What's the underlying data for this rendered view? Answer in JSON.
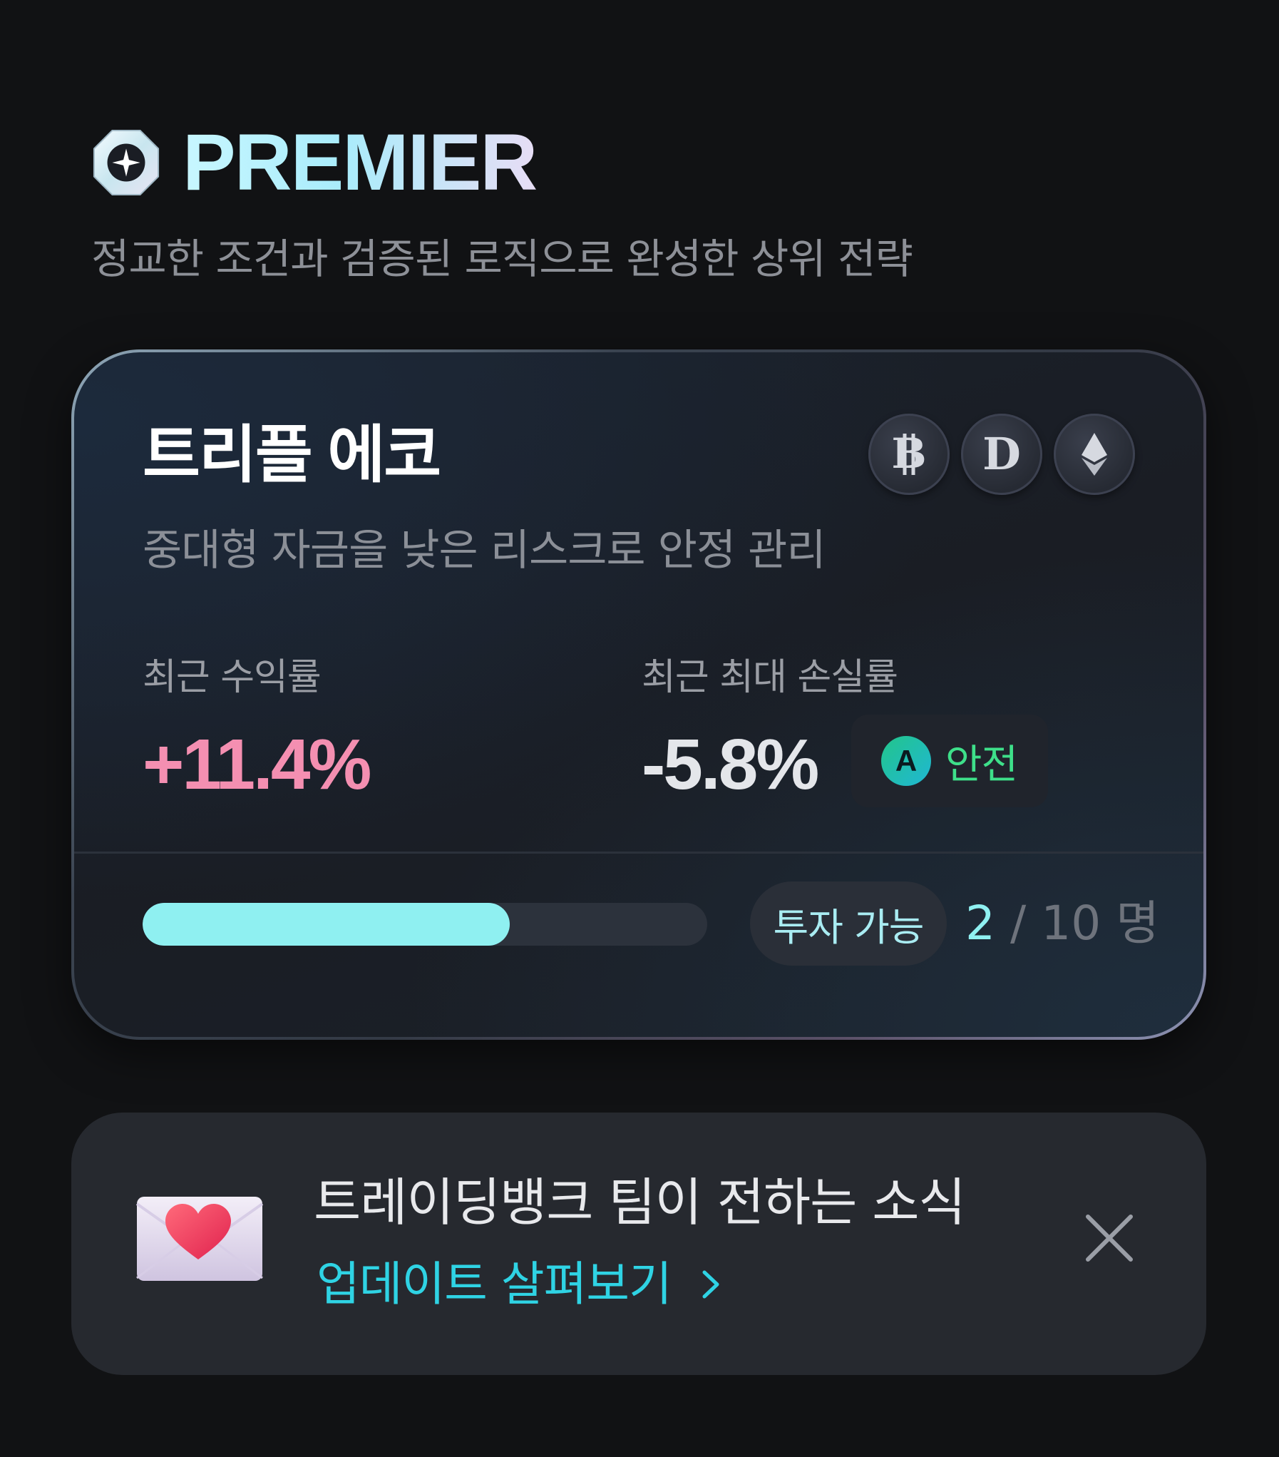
{
  "header": {
    "brand": "PREMIER",
    "tagline": "정교한 조건과 검증된 로직으로 완성한 상위 전략"
  },
  "strategy": {
    "title": "트리플 에코",
    "description": "중대형 자금을 낮은 리스크로 안정 관리",
    "coins": [
      {
        "icon": "bitcoin-icon",
        "symbol": "B"
      },
      {
        "icon": "dogecoin-icon",
        "symbol": "D"
      },
      {
        "icon": "ethereum-icon",
        "symbol": ""
      }
    ],
    "metrics": {
      "recent_return_label": "최근 수익률",
      "recent_return_value": "+11.4%",
      "max_loss_label": "최근 최대 손실률",
      "max_loss_value": "-5.8%",
      "grade": "A",
      "safety_label": "안전"
    },
    "capacity": {
      "progress_fraction": 0.65,
      "status_label": "투자 가능",
      "current": "2",
      "separator": "/",
      "total": "10",
      "unit": "명"
    }
  },
  "news": {
    "title": "트레이딩뱅크 팀이 전하는 소식",
    "link_label": "업데이트 살펴보기"
  },
  "colors": {
    "background": "#111214",
    "return_positive": "#f48fb1",
    "safety_green": "#3ee08a",
    "accent_cyan": "#8ff0f1",
    "link_cyan": "#2fd3e4"
  }
}
